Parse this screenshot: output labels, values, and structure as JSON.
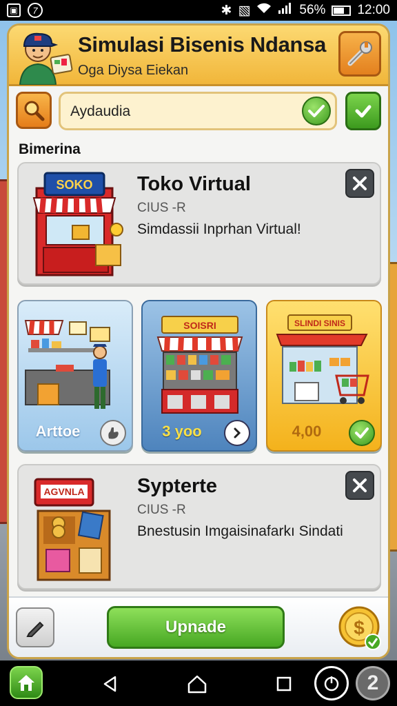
{
  "status_bar": {
    "battery": "56%",
    "time": "12:00"
  },
  "header": {
    "title": "Simulasi Bisenis Ndansa",
    "subtitle": "Oga Diysa Eiekan"
  },
  "search": {
    "value": "Aydaudia"
  },
  "section": {
    "label": "Bimerina"
  },
  "cards": [
    {
      "title": "Toko Virtual",
      "code": "CIUS -R",
      "description": "Simdassii Inprhan Virtual!",
      "sign": "SOKO"
    },
    {
      "title": "Sypterte",
      "code": "CIUS -R",
      "description": "Bnestusin Imgaisinafarkı Sindati",
      "sign": "AGVNLA"
    }
  ],
  "tiles": [
    {
      "label": "Arttoe"
    },
    {
      "label": "3 yoo",
      "sign": "SOISRI"
    },
    {
      "label": "4,00",
      "sign": "SLINDI SINIS"
    }
  ],
  "footer": {
    "upgrade_label": "Upnade"
  },
  "nav": {
    "badge": "2"
  },
  "colors": {
    "header_gold": "#f1b63a",
    "action_green": "#47a823",
    "tile_blue": "#4e84bd",
    "tile_yellow": "#f4b21c"
  }
}
